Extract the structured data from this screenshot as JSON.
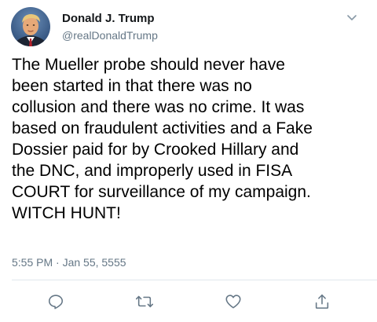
{
  "tweet": {
    "author": {
      "display_name": "Donald J. Trump",
      "handle": "@realDonaldTrump",
      "avatar_icon": "profile-photo"
    },
    "menu_icon": "chevron-down-icon",
    "text": "The Mueller probe should never have\nbeen started in that there was no\ncollusion and there was no crime. It was\nbased on fraudulent activities and a Fake\nDossier paid for by Crooked Hillary and\nthe DNC, and improperly used in FISA\nCOURT for surveillance of my campaign.\nWITCH HUNT!",
    "timestamp": "5:55 PM · Jan 55, 5555",
    "actions": [
      {
        "name": "reply",
        "icon": "reply-icon"
      },
      {
        "name": "retweet",
        "icon": "retweet-icon"
      },
      {
        "name": "like",
        "icon": "heart-icon"
      },
      {
        "name": "share",
        "icon": "share-icon"
      }
    ]
  },
  "colors": {
    "text": "#14171a",
    "secondary_text": "#657786",
    "icon": "#657786",
    "divider": "#e1e8ed",
    "background": "#ffffff"
  }
}
